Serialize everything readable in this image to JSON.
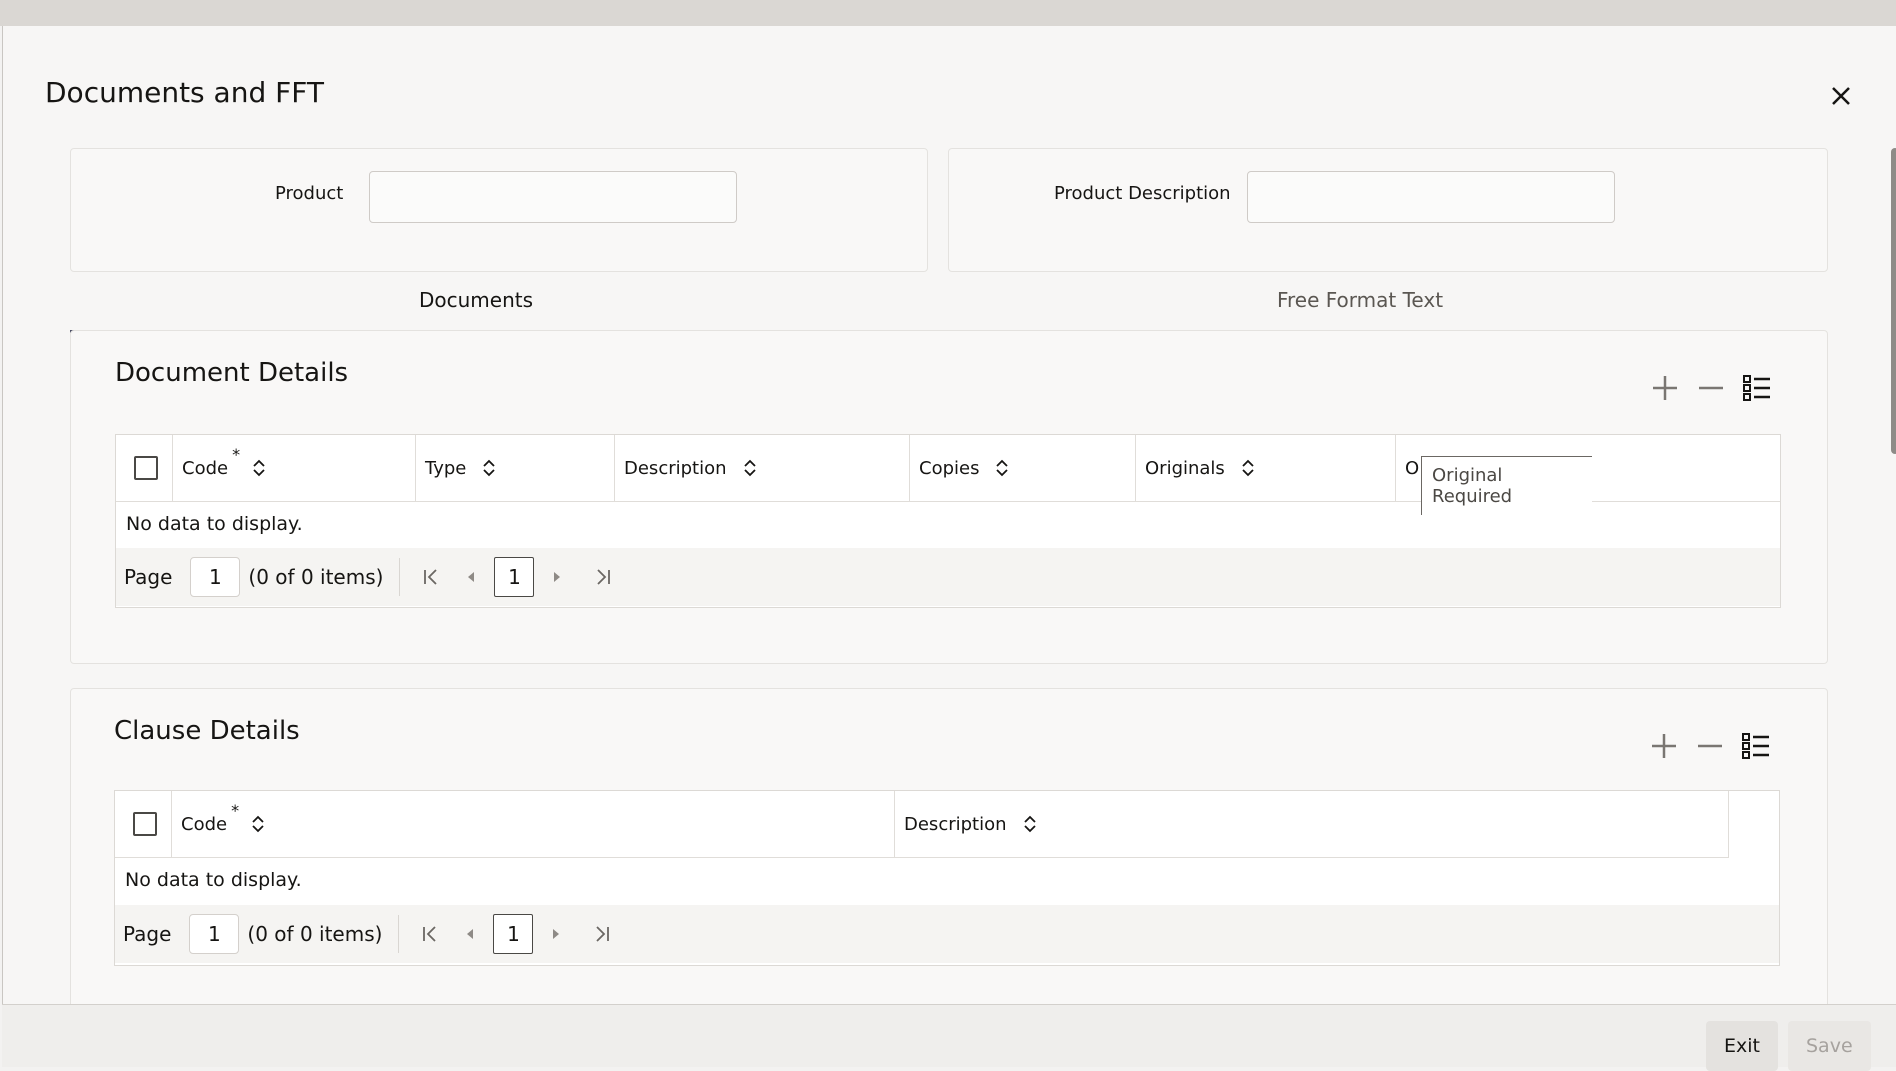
{
  "dialog": {
    "title": "Documents and FFT"
  },
  "header_fields": {
    "product_label": "Product",
    "product_value": "",
    "product_description_label": "Product Description",
    "product_description_value": ""
  },
  "tabs": [
    {
      "label": "Documents",
      "active": true
    },
    {
      "label": "Free Format Text",
      "active": false
    }
  ],
  "document_details": {
    "title": "Document Details",
    "columns": [
      "Code",
      "Type",
      "Description",
      "Copies",
      "Originals",
      "O"
    ],
    "required_marker": "*",
    "empty_text": "No data to display.",
    "pager": {
      "page_label": "Page",
      "page_value": "1",
      "count": "(0 of 0 items)",
      "current": "1"
    },
    "tooltip": "Original Required"
  },
  "clause_details": {
    "title": "Clause Details",
    "columns": [
      "Code",
      "Description"
    ],
    "required_marker": "*",
    "empty_text": "No data to display.",
    "pager": {
      "page_label": "Page",
      "page_value": "1",
      "count": "(0 of 0 items)",
      "current": "1"
    }
  },
  "footer": {
    "exit_label": "Exit",
    "save_label": "Save"
  },
  "icons": [
    "close-icon",
    "add-icon",
    "remove-icon",
    "column-list-icon",
    "sort-icon",
    "first-page-icon",
    "previous-page-icon",
    "next-page-icon",
    "last-page-icon"
  ],
  "colors": {
    "tab_underline": "#4a4d63",
    "background": "#f7f6f5"
  }
}
